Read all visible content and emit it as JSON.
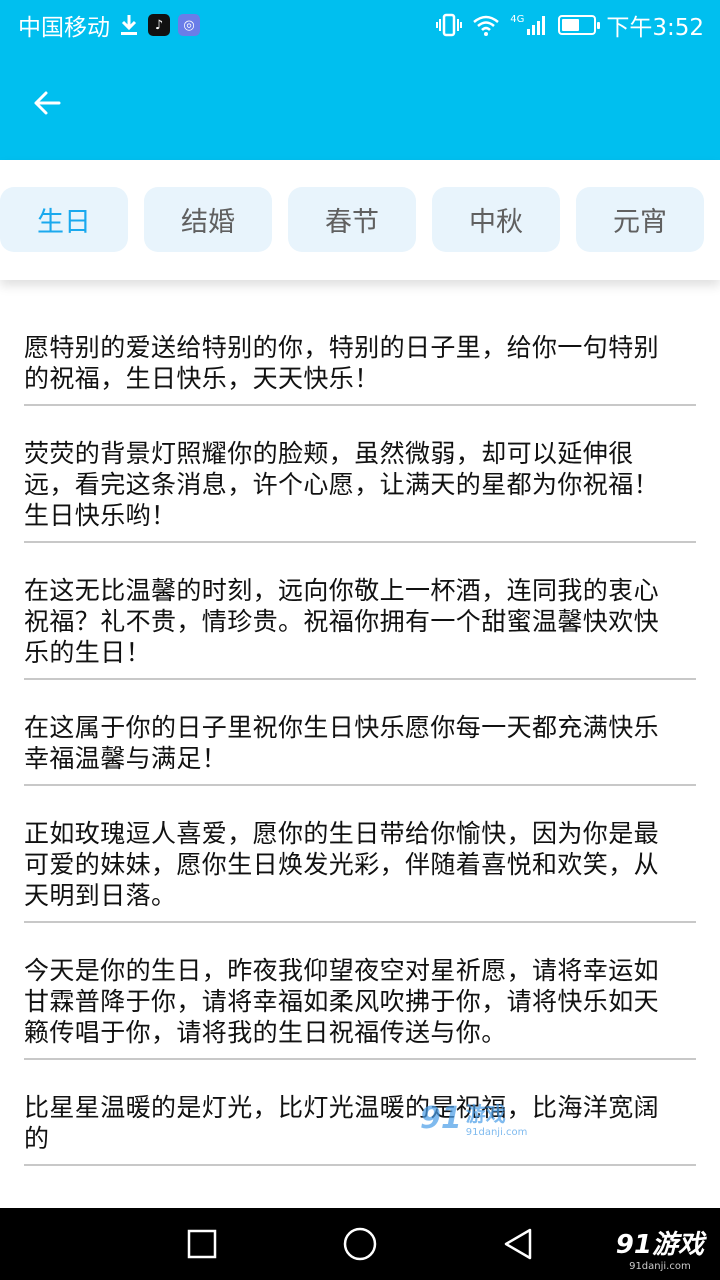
{
  "status_bar": {
    "carrier": "中国移动",
    "network": "4G",
    "time": "下午3:52",
    "battery_level": 0.55
  },
  "tabs": [
    {
      "label": "生日",
      "active": true
    },
    {
      "label": "结婚",
      "active": false
    },
    {
      "label": "春节",
      "active": false
    },
    {
      "label": "中秋",
      "active": false
    },
    {
      "label": "元宵",
      "active": false
    }
  ],
  "messages": [
    "愿特别的爱送给特别的你，特别的日子里，给你一句特别的祝福，生日快乐，天天快乐！",
    "荧荧的背景灯照耀你的脸颊，虽然微弱，却可以延伸很远，看完这条消息，许个心愿，让满天的星都为你祝福！生日快乐哟！",
    "在这无比温馨的时刻，远向你敬上一杯酒，连同我的衷心祝福？礼不贵，情珍贵。祝福你拥有一个甜蜜温馨快欢快乐的生日！",
    "在这属于你的日子里祝你生日快乐愿你每一天都充满快乐幸福温馨与满足！",
    "正如玫瑰逗人喜爱，愿你的生日带给你愉快，因为你是最可爱的妹妹，愿你生日焕发光彩，伴随着喜悦和欢笑，从天明到日落。",
    "今天是你的生日，昨夜我仰望夜空对星祈愿，请将幸运如甘霖普降于你，请将幸福如柔风吹拂于你，请将快乐如天籁传唱于你，请将我的生日祝福传送与你。",
    "比星星温暖的是灯光，比灯光温暖的是祝福，比海洋宽阔的"
  ],
  "watermark": {
    "logo": "91",
    "name": "游戏",
    "site": "91danji.com"
  },
  "colors": {
    "primary": "#00bfef",
    "tab_active": "#1aa9ee",
    "tab_bg": "#e8f4fc"
  }
}
